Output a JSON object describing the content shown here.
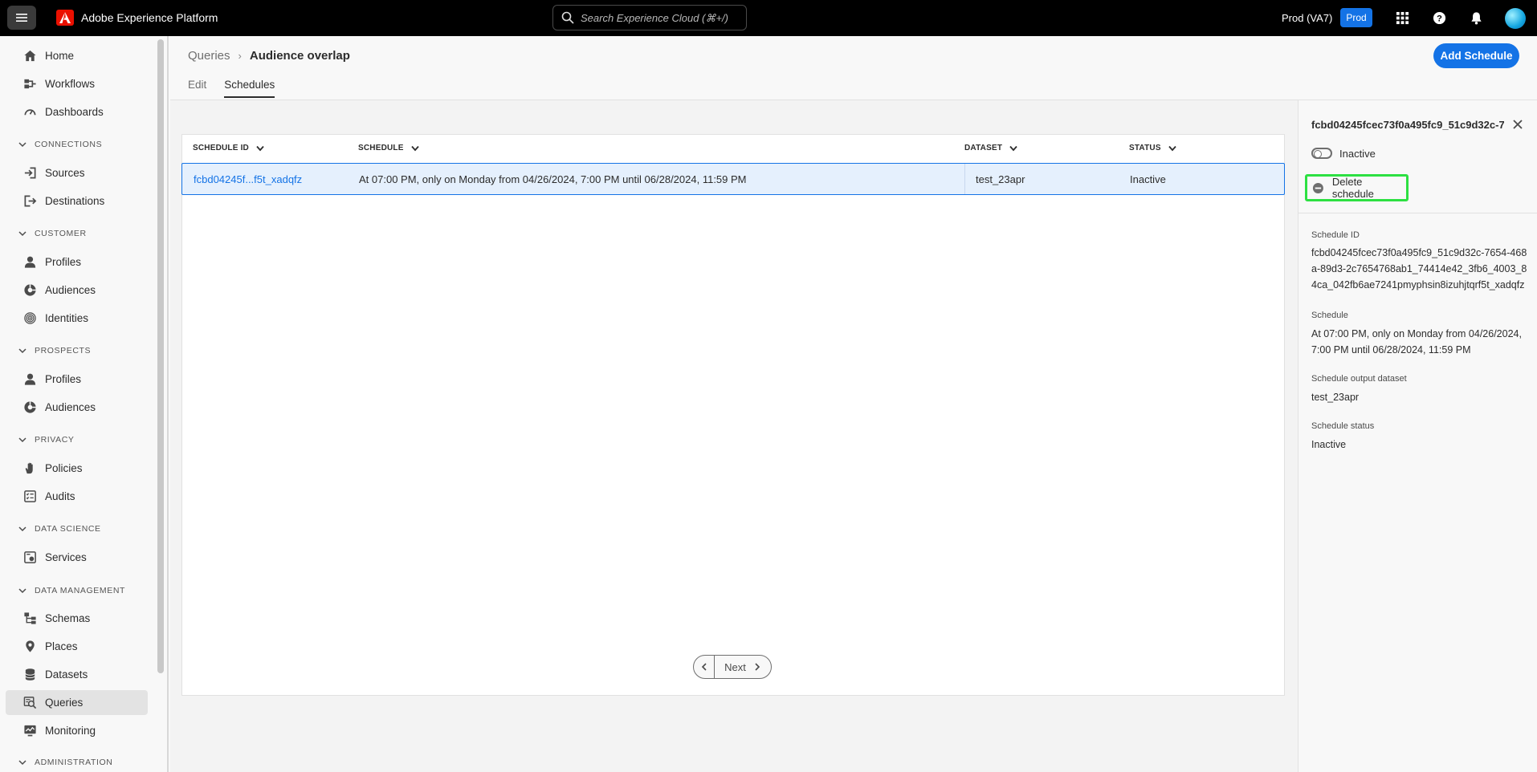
{
  "app": {
    "title": "Adobe Experience Platform",
    "search_placeholder": "Search Experience Cloud (⌘+/)",
    "org": "Prod (VA7)",
    "env_badge": "Prod"
  },
  "sidebar": {
    "items": [
      {
        "label": "Home",
        "icon": "home-icon"
      },
      {
        "label": "Workflows",
        "icon": "workflow-icon"
      },
      {
        "label": "Dashboards",
        "icon": "dashboard-icon"
      },
      {
        "section": "CONNECTIONS"
      },
      {
        "label": "Sources",
        "icon": "sources-icon"
      },
      {
        "label": "Destinations",
        "icon": "destinations-icon"
      },
      {
        "section": "CUSTOMER"
      },
      {
        "label": "Profiles",
        "icon": "profile-icon"
      },
      {
        "label": "Audiences",
        "icon": "audiences-icon"
      },
      {
        "label": "Identities",
        "icon": "fingerprint-icon"
      },
      {
        "section": "PROSPECTS"
      },
      {
        "label": "Profiles",
        "icon": "profile-icon"
      },
      {
        "label": "Audiences",
        "icon": "audiences-icon"
      },
      {
        "section": "PRIVACY"
      },
      {
        "label": "Policies",
        "icon": "hand-icon"
      },
      {
        "label": "Audits",
        "icon": "audits-icon"
      },
      {
        "section": "DATA SCIENCE"
      },
      {
        "label": "Services",
        "icon": "services-icon"
      },
      {
        "section": "DATA MANAGEMENT"
      },
      {
        "label": "Schemas",
        "icon": "schemas-icon"
      },
      {
        "label": "Places",
        "icon": "pin-icon"
      },
      {
        "label": "Datasets",
        "icon": "database-icon"
      },
      {
        "label": "Queries",
        "icon": "queries-icon",
        "active": true
      },
      {
        "label": "Monitoring",
        "icon": "monitoring-icon"
      },
      {
        "section": "ADMINISTRATION"
      }
    ]
  },
  "header": {
    "breadcrumb_parent": "Queries",
    "breadcrumb_current": "Audience overlap",
    "tabs": [
      "Edit",
      "Schedules"
    ],
    "active_tab": "Schedules",
    "add_button": "Add Schedule"
  },
  "table": {
    "columns": [
      "SCHEDULE ID",
      "SCHEDULE",
      "DATASET",
      "STATUS"
    ],
    "rows": [
      {
        "schedule_id": "fcbd04245f...f5t_xadqfz",
        "schedule": "At 07:00 PM, only on Monday from 04/26/2024, 7:00 PM until 06/28/2024, 11:59 PM",
        "dataset": "test_23apr",
        "status": "Inactive"
      }
    ]
  },
  "pager": {
    "next": "Next"
  },
  "panel": {
    "title": "fcbd04245fcec73f0a495fc9_51c9d32c-7...",
    "toggle_label": "Inactive",
    "toggle_on": false,
    "delete_label": "Delete schedule",
    "fields": [
      {
        "label": "Schedule ID",
        "value": "fcbd04245fcec73f0a495fc9_51c9d32c-7654-468a-89d3-2c7654768ab1_74414e42_3fb6_4003_84ca_042fb6ae7241pmyphsin8izuhjtqrf5t_xadqfz"
      },
      {
        "label": "Schedule",
        "value": "At 07:00 PM, only on Monday from 04/26/2024, 7:00 PM until 06/28/2024, 11:59 PM"
      },
      {
        "label": "Schedule output dataset",
        "value": "test_23apr"
      },
      {
        "label": "Schedule status",
        "value": "Inactive"
      }
    ]
  },
  "colors": {
    "accent": "#1473e6",
    "highlight": "#2de042",
    "brand_red": "#eb1000"
  }
}
